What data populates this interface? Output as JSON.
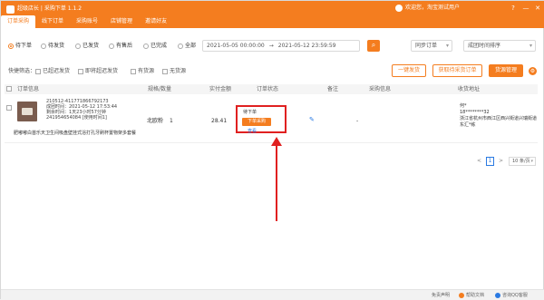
{
  "app": {
    "title": "超级店长 | 采购下单 1.1.2"
  },
  "tabs": [
    "订单采购",
    "线下订单",
    "采购账号",
    "店铺管理",
    "邀请好友"
  ],
  "user": {
    "name": "欢迎您，淘宝测试用户"
  },
  "window_controls": {
    "help": "?",
    "minimize": "—",
    "close": "✕"
  },
  "filters": {
    "status_options": [
      "待下单",
      "待发货",
      "已发货",
      "有售后",
      "已完成",
      "全部"
    ],
    "selected_status": "待下单",
    "date_start": "2021-05-05 00:00:00",
    "date_sep": "→",
    "date_end": "2021-05-12 23:59:59",
    "sync_select": "同步订单",
    "sort_select": "成团时间排序"
  },
  "quick": {
    "label": "快捷筛选：",
    "options": [
      "已超迟发货",
      "即将超迟发货",
      "有货源",
      "无货源"
    ],
    "actions": [
      "一键发货",
      "获取待采货订单",
      "货源管理"
    ]
  },
  "table": {
    "headers": [
      "订单信息",
      "规格/数量",
      "实付金额",
      "订单状态",
      "备注",
      "采购信息",
      "收货地址"
    ]
  },
  "order": {
    "info_lines": [
      "210512-411771866792173",
      "成团时间：2021-05-12 17:53:44",
      "剩余时间：1天23小时57分钟",
      "241954654084 [使用时间1]"
    ],
    "product_name": "肥嘟嘟白首乐天卫生间吸盘壁挂式浴打孔牙刷杯置物架多套餐",
    "spec": "北欧粉",
    "qty": "1",
    "amount": "28.41",
    "status": "待下单",
    "order_button": "下单采购",
    "status_link": "查看",
    "purchase": "-",
    "address": [
      "何*",
      "18********32",
      "浙江省杭州市西江区西兴街道兴瑞街道东汇*栋"
    ]
  },
  "pager": {
    "prev": "<",
    "page": "1",
    "next": ">",
    "per_page": "10 条/页"
  },
  "footer": {
    "disclaimer": "免责声明",
    "help_docs": "帮助文档",
    "qq_service": "咨询QQ客服"
  },
  "colors": {
    "brand": "#f47d1f",
    "highlight": "#e02020",
    "link": "#2a7ae2"
  }
}
